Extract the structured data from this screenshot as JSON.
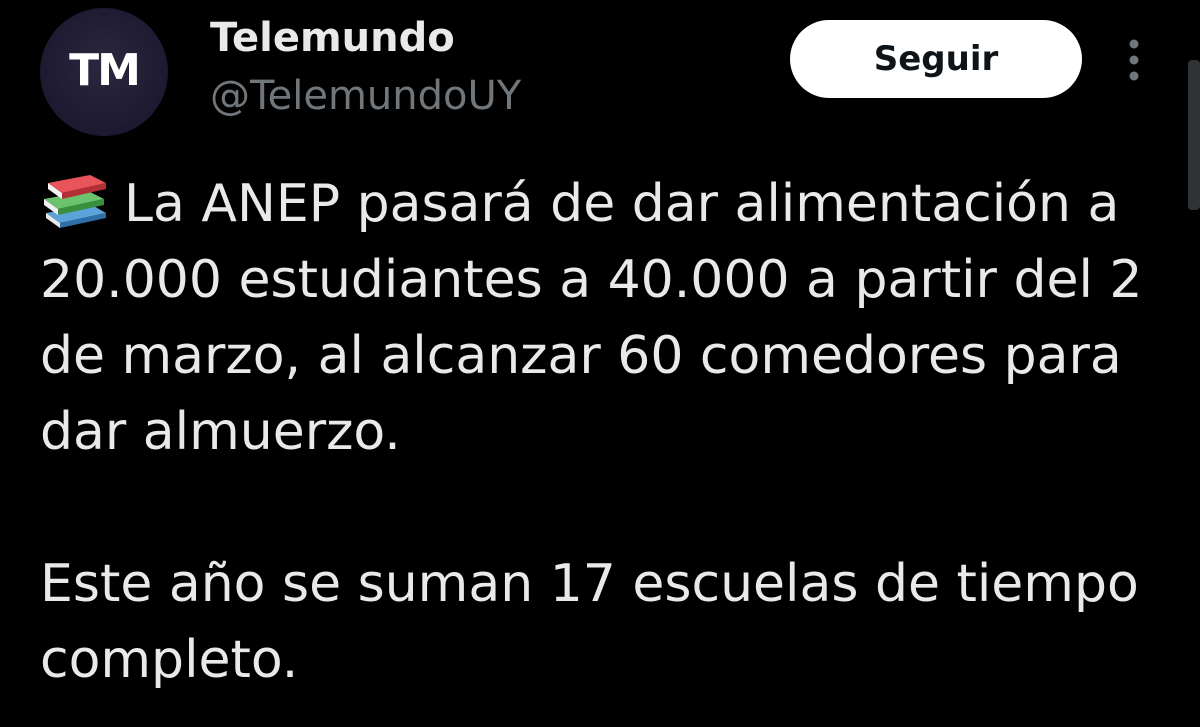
{
  "account": {
    "avatar_text": "TM",
    "display_name": "Telemundo",
    "handle": "@TelemundoUY"
  },
  "actions": {
    "follow_label": "Seguir",
    "more_icon": "more-vertical-icon"
  },
  "tweet": {
    "emoji_icon": "books-emoji-icon",
    "paragraph_1": "La ANEP pasará de dar alimentación a 20.000 estudiantes a 40.000 a partir del 2 de marzo, al alcanzar 60 comedores para dar almuerzo.",
    "paragraph_2": "Este año se suman 17 escuelas de tiempo completo."
  },
  "colors": {
    "background": "#000000",
    "primary_text": "#e7e9ea",
    "secondary_text": "#71767b",
    "button_bg": "#ffffff",
    "button_text": "#0f1419"
  }
}
